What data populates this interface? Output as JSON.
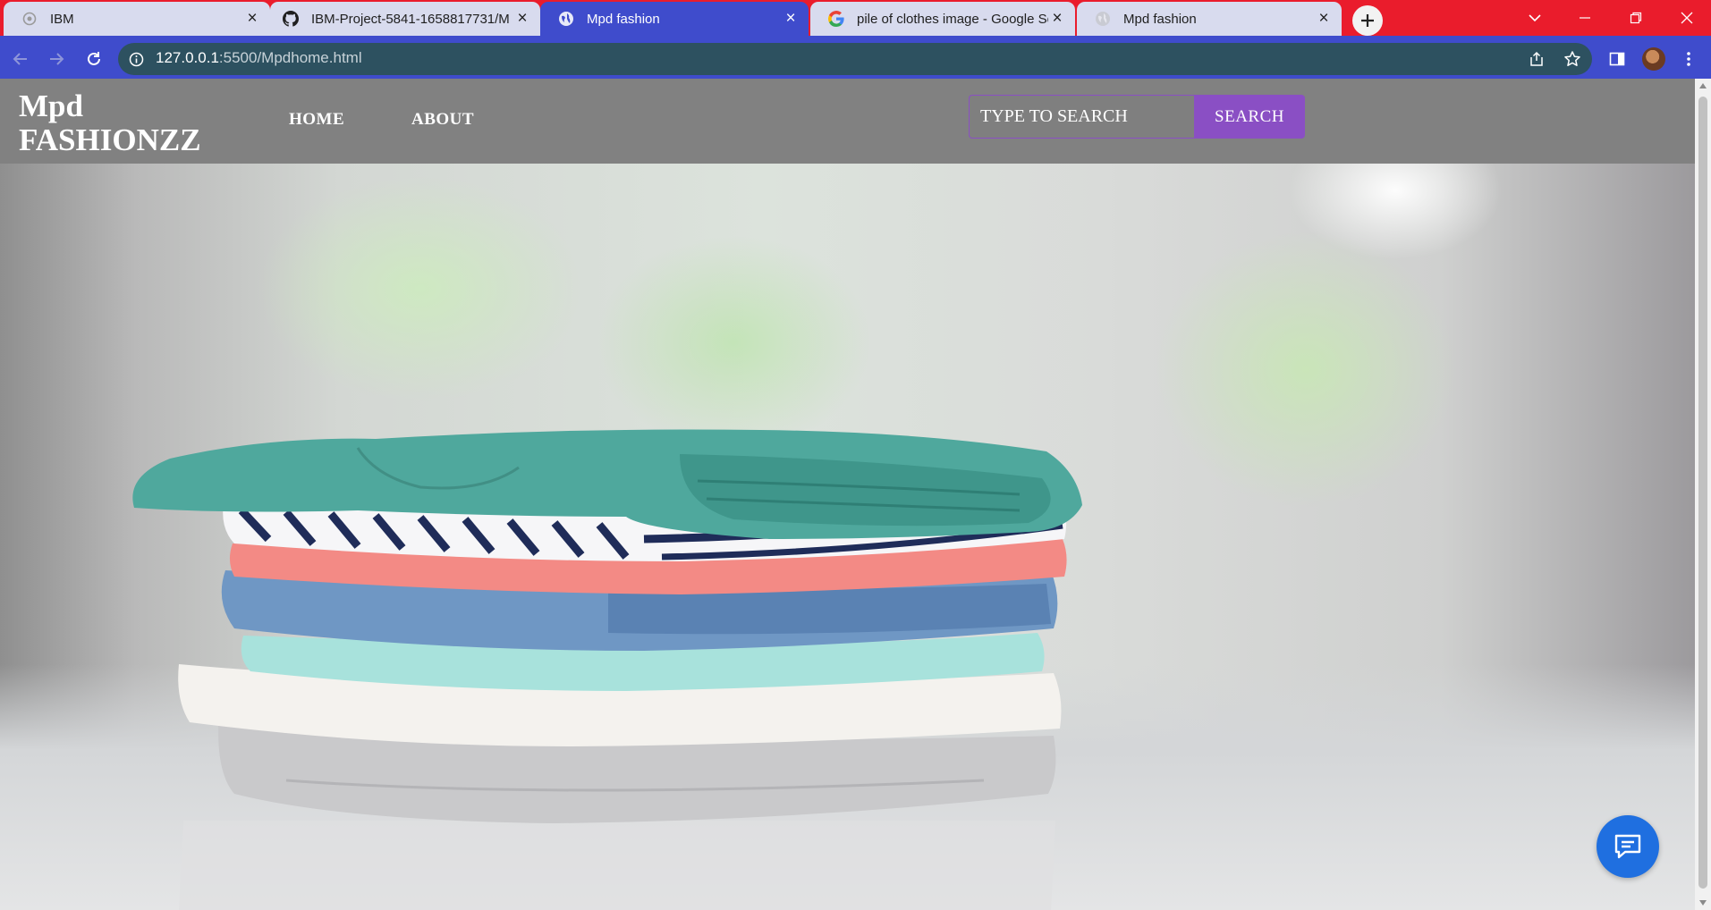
{
  "browser": {
    "tabs": [
      {
        "title": "IBM",
        "favicon": "ibm-icon",
        "active": false
      },
      {
        "title": "IBM-Project-5841-1658817731/M",
        "favicon": "github-icon",
        "active": false
      },
      {
        "title": "Mpd fashion",
        "favicon": "globe-icon",
        "active": true
      },
      {
        "title": "pile of clothes image - Google Se",
        "favicon": "google-icon",
        "active": false
      },
      {
        "title": "Mpd fashion",
        "favicon": "globe-icon",
        "active": false
      }
    ],
    "url_host": "127.0.0.1",
    "url_path": ":5500/Mpdhome.html",
    "colors": {
      "tabstrip": "#ea1c2c",
      "toolbar": "#3f4ccc",
      "omnibox": "#2d5160"
    }
  },
  "site": {
    "logo_line1": "Mpd",
    "logo_line2": "FASHIONZZ",
    "nav": [
      {
        "label": "HOME"
      },
      {
        "label": "ABOUT"
      }
    ],
    "search_placeholder": "TYPE TO SEARCH",
    "search_button": "SEARCH",
    "colors": {
      "header": "#818181",
      "accent": "#8a4fc4",
      "chat_button": "#1f6fe0"
    },
    "hero_image": "pile-of-folded-clothes"
  }
}
